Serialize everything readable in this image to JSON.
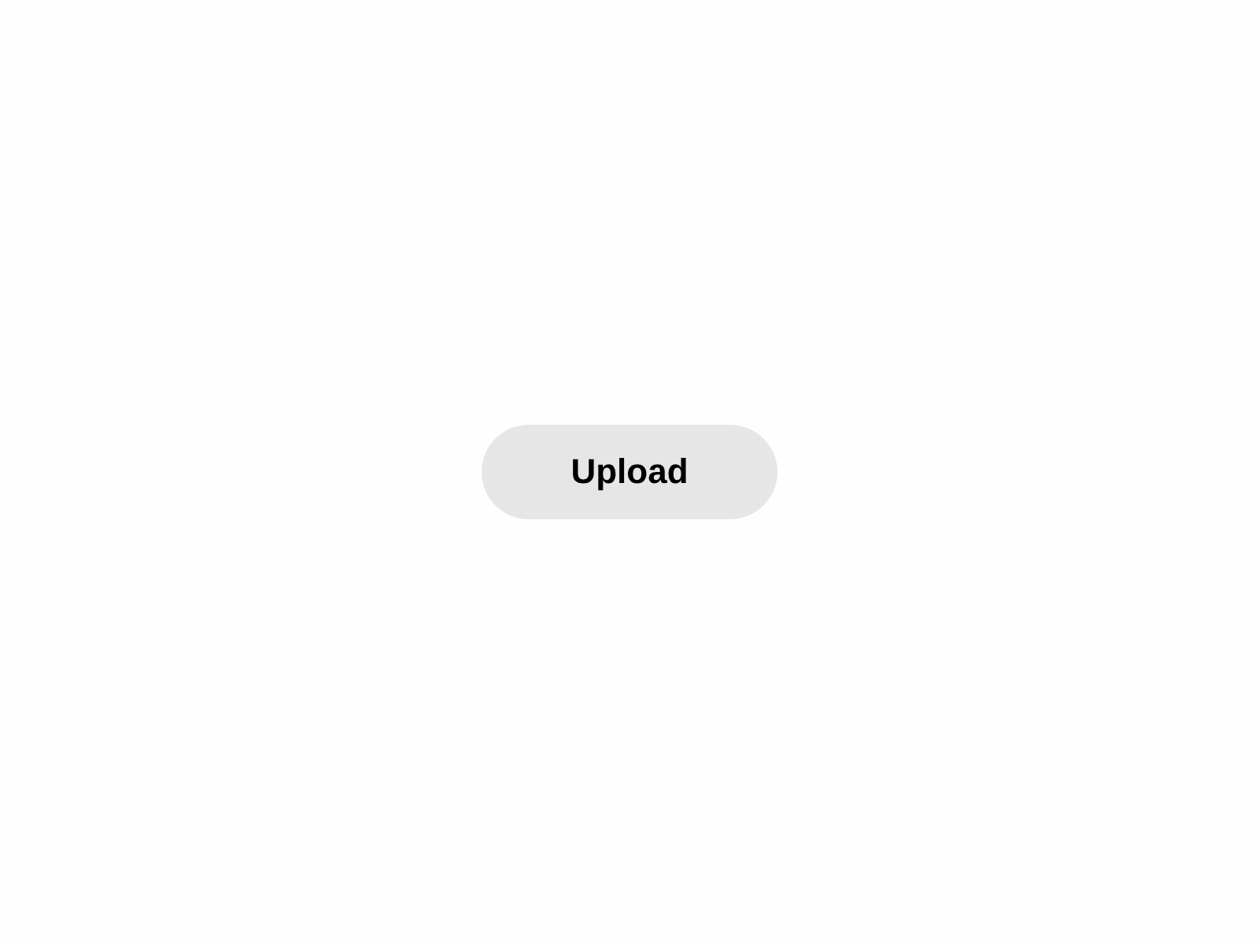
{
  "button": {
    "label": "Upload"
  }
}
